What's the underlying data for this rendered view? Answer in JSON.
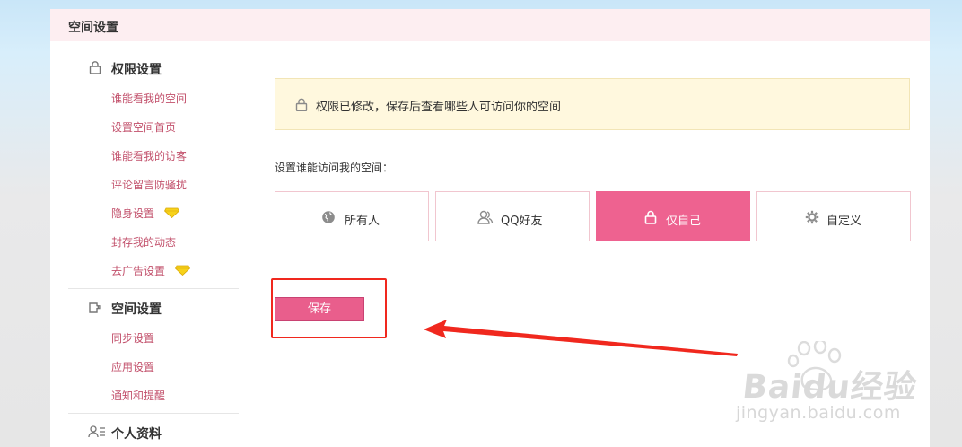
{
  "panel": {
    "title": "空间设置"
  },
  "sidebar": {
    "groups": [
      {
        "title": "权限设置",
        "icon": "lock-icon",
        "items": [
          {
            "label": "谁能看我的空间"
          },
          {
            "label": "设置空间首页"
          },
          {
            "label": "谁能看我的访客"
          },
          {
            "label": "评论留言防骚扰"
          },
          {
            "label": "隐身设置",
            "badge": "diamond-icon"
          },
          {
            "label": "封存我的动态"
          },
          {
            "label": "去广告设置",
            "badge": "diamond-icon"
          }
        ]
      },
      {
        "title": "空间设置",
        "icon": "puzzle-icon",
        "items": [
          {
            "label": "同步设置"
          },
          {
            "label": "应用设置"
          },
          {
            "label": "通知和提醒"
          }
        ]
      },
      {
        "title": "个人资料",
        "icon": "user-list-icon",
        "items": []
      }
    ]
  },
  "notice": {
    "text": "权限已修改，保存后查看哪些人可访问你的空间",
    "icon": "lock-icon",
    "bg": "#fff8de"
  },
  "prompt": "设置谁能访问我的空间：",
  "options": [
    {
      "label": "所有人",
      "icon": "globe-icon",
      "selected": false
    },
    {
      "label": "QQ好友",
      "icon": "friends-icon",
      "selected": false
    },
    {
      "label": "仅自己",
      "icon": "lock-icon",
      "selected": true
    },
    {
      "label": "自定义",
      "icon": "gear-icon",
      "selected": false
    }
  ],
  "save_label": "保存",
  "colors": {
    "accent": "#ee6290",
    "link": "#c2506b",
    "highlight_box": "#f0281e"
  },
  "watermark": {
    "brand": "Baidu经验",
    "url": "jingyan.baidu.com"
  }
}
